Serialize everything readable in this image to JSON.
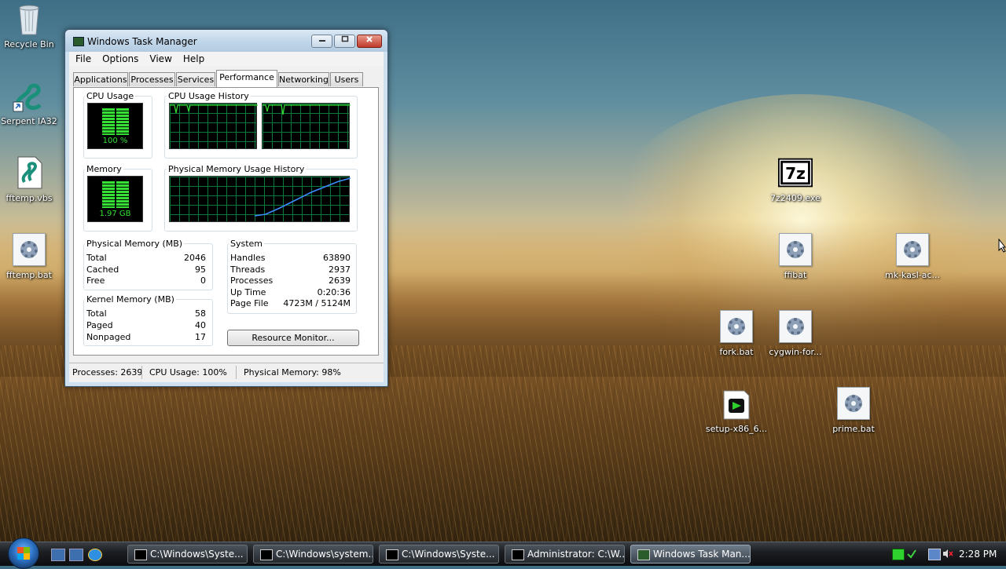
{
  "desktop": {
    "icons": [
      {
        "label": "Recycle Bin",
        "icon": "recycle-bin-icon"
      },
      {
        "label": "Serpent IA32",
        "icon": "serpent-icon"
      },
      {
        "label": "fftemp.vbs",
        "icon": "script-icon"
      },
      {
        "label": "fftemp.bat",
        "icon": "batch-file-icon"
      },
      {
        "label": "7z2409.exe",
        "icon": "7zip-icon"
      },
      {
        "label": "ffibat",
        "icon": "batch-file-icon"
      },
      {
        "label": "mk-kasl-ac...",
        "icon": "batch-file-icon"
      },
      {
        "label": "fork.bat",
        "icon": "batch-file-icon"
      },
      {
        "label": "cygwin-for...",
        "icon": "batch-file-icon"
      },
      {
        "label": "setup-x86_6...",
        "icon": "installer-icon"
      },
      {
        "label": "prime.bat",
        "icon": "batch-file-icon"
      }
    ]
  },
  "window": {
    "title": "Windows Task Manager",
    "menu": [
      "File",
      "Options",
      "View",
      "Help"
    ],
    "tabs": [
      "Applications",
      "Processes",
      "Services",
      "Performance",
      "Networking",
      "Users"
    ],
    "active_tab": "Performance",
    "performance": {
      "cpu_usage_label": "CPU Usage",
      "cpu_usage_value": "100 %",
      "cpu_usage_percent": 100,
      "cpu_history_label": "CPU Usage History",
      "memory_label": "Memory",
      "memory_value": "1.97 GB",
      "memory_history_label": "Physical Memory Usage History",
      "physical_memory": {
        "label": "Physical Memory (MB)",
        "rows": [
          {
            "k": "Total",
            "v": "2046"
          },
          {
            "k": "Cached",
            "v": "95"
          },
          {
            "k": "Free",
            "v": "0"
          }
        ]
      },
      "kernel_memory": {
        "label": "Kernel Memory (MB)",
        "rows": [
          {
            "k": "Total",
            "v": "58"
          },
          {
            "k": "Paged",
            "v": "40"
          },
          {
            "k": "Nonpaged",
            "v": "17"
          }
        ]
      },
      "system": {
        "label": "System",
        "rows": [
          {
            "k": "Handles",
            "v": "63890"
          },
          {
            "k": "Threads",
            "v": "2937"
          },
          {
            "k": "Processes",
            "v": "2639"
          },
          {
            "k": "Up Time",
            "v": "0:20:36"
          },
          {
            "k": "Page File",
            "v": "4723M / 5124M"
          }
        ]
      },
      "resource_monitor_button": "Resource Monitor..."
    },
    "status": {
      "processes": "Processes: 2639",
      "cpu": "CPU Usage: 100%",
      "memory": "Physical Memory: 98%"
    }
  },
  "taskbar": {
    "buttons": [
      {
        "label": "C:\\Windows\\Syste..."
      },
      {
        "label": "C:\\Windows\\system..."
      },
      {
        "label": "C:\\Windows\\Syste..."
      },
      {
        "label": "Administrator: C:\\W..."
      },
      {
        "label": "Windows Task Man..."
      }
    ],
    "clock": "2:28 PM"
  },
  "colors": {
    "meter_green": "#35e135",
    "grid_green": "#0c7a3a",
    "memory_line": "#3b8cff",
    "close_red": "#c0392b"
  }
}
